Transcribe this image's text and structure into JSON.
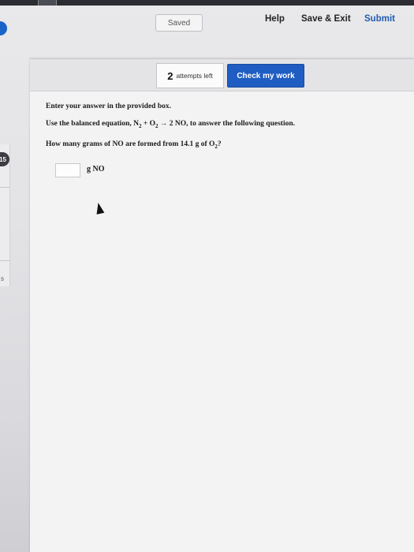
{
  "header": {
    "saved_label": "Saved",
    "help_label": "Help",
    "save_exit_label": "Save & Exit",
    "submit_label": "Submit"
  },
  "question_bar": {
    "attempts_number": "2",
    "attempts_label": "attempts left",
    "check_button_label": "Check my work"
  },
  "question": {
    "instruction": "Enter your answer in the provided box.",
    "equation_prefix": "Use the balanced equation, N",
    "n2_sub": "2",
    "plus": " + O",
    "o2_sub": "2",
    "arrow_part": " → 2 NO, to answer the following question.",
    "ask_prefix": "How many grams of NO are formed from 14.1 g of O",
    "ask_sub": "2",
    "ask_suffix": "?",
    "answer_value": "",
    "unit": "g NO"
  },
  "side": {
    "badge": "15",
    "letter": "s"
  },
  "colors": {
    "accent": "#1f5dc2",
    "submit": "#1f5bb0"
  }
}
